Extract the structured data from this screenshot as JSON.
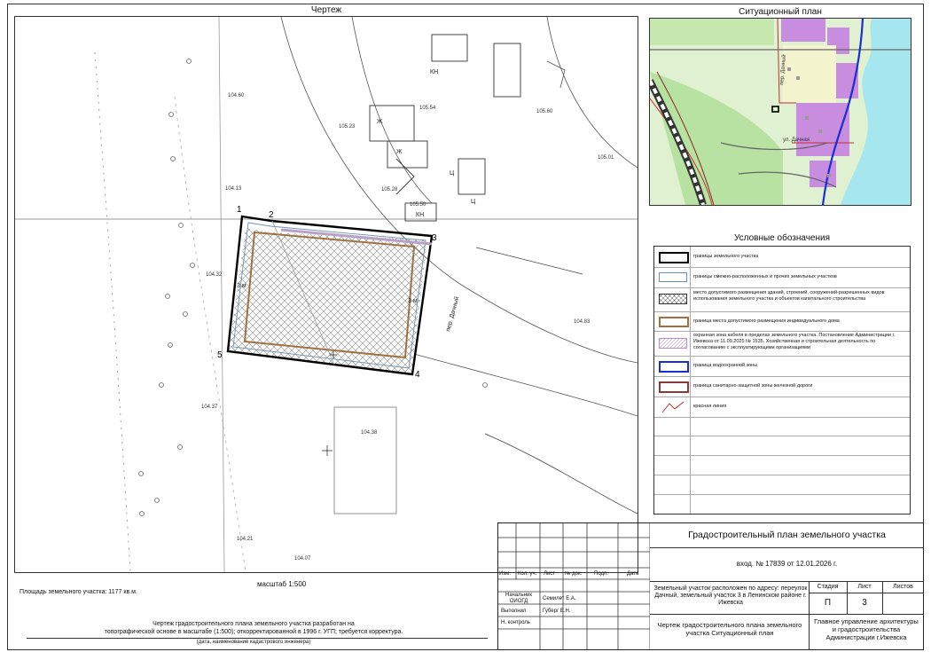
{
  "drawing": {
    "title": "Чертеж",
    "scale": "масштаб 1:500",
    "area": "Площадь земельного участка: 1177 кв.м.",
    "basis_line1": "Чертеж градостроительного плана земельного участка разработан на",
    "basis_line2": "топографической основе в масштабе (1:500); откорректированной в 1996 г. УГП; требуется корректура.",
    "engineer_note": "(дата, наименование кадастрового инженера)",
    "points": [
      "1",
      "2",
      "3",
      "4",
      "5"
    ],
    "setback_labels": [
      "3 м",
      "3 м"
    ],
    "elevations": [
      "104.60",
      "105.23",
      "104.13",
      "104.32",
      "104.37",
      "104.38",
      "104.21",
      "104.07",
      "104.83",
      "105.01",
      "105.60",
      "105.50",
      "105.54",
      "105.28"
    ],
    "street_label": "пер. Дачный",
    "building_labels": [
      "КН",
      "Ж",
      "Ж",
      "Ц",
      "КН",
      "Ц"
    ]
  },
  "situation": {
    "title": "Ситуационный план",
    "street_labels": [
      "пер. Дачный",
      "ул. Дачная"
    ]
  },
  "legend": {
    "title": "Условные обозначения",
    "items": [
      {
        "name": "parcel-boundary",
        "text": "границы земельного участка"
      },
      {
        "name": "adjacent-boundary",
        "text": "границы смежно-расположенных и прочих земельных участков"
      },
      {
        "name": "building-area",
        "text": "место допустимого размещения зданий, строений, сооружений-разрешенных видов использования земельного участка и объектов капитального строительства"
      },
      {
        "name": "house-boundary",
        "text": "граница места допустимого размещения индивидуального дома"
      },
      {
        "name": "cable-zone",
        "text": "охранная зона кабеля в пределах земельного участка. Постановление Администрации г. Ижевска от 11.09.2025 № 1535. Хозяйственная и строительная деятельность по согласованию с эксплуатирующими организациями"
      },
      {
        "name": "water-zone",
        "text": "граница водоохранной зоны"
      },
      {
        "name": "rail-zone",
        "text": "граница санитарно-защитной зоны железной дороги"
      },
      {
        "name": "red-line",
        "text": "красная линия"
      }
    ]
  },
  "stamp": {
    "main_title": "Градостроительный план земельного участка",
    "incoming": "вход. № 17839 от 12.01.2026 г.",
    "col_headers": [
      "Изм.",
      "Кол. уч.",
      "Лист",
      "№ док.",
      "Подп.",
      "Дата"
    ],
    "roles": [
      {
        "role": "Начальник ОИОГД",
        "name": "Семилет Е.А."
      },
      {
        "role": "Выполнил",
        "name": "Губерг Е.Н."
      },
      {
        "role": "Н. контроль",
        "name": ""
      }
    ],
    "address": "Земельный участок расположен по адресу: переулок Дачный, земельный участок 3 в Ленинском районе г. Ижевска",
    "stage_header": "Стадия",
    "sheet_header": "Лист",
    "sheets_header": "Листов",
    "stage": "П",
    "sheet": "3",
    "sheets": "",
    "sheet_title": "Чертеж градостроительного плана земельного участка Ситуационный план",
    "org": "Главное управление архитектуры и градостроительства Администрации г.Ижевска"
  }
}
